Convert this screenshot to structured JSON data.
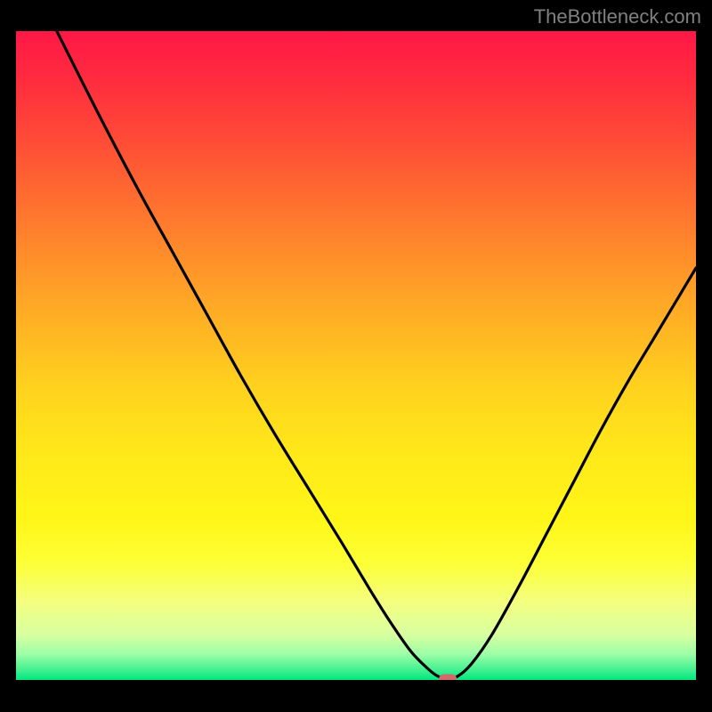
{
  "watermark": "TheBottleneck.com",
  "chart_data": {
    "type": "line",
    "title": "",
    "xlabel": "",
    "ylabel": "",
    "xlim": [
      0,
      100
    ],
    "ylim": [
      0,
      100
    ],
    "gradient_stops": [
      {
        "offset": 0.0,
        "color": "#ff1846"
      },
      {
        "offset": 0.07,
        "color": "#ff2a3f"
      },
      {
        "offset": 0.15,
        "color": "#ff4538"
      },
      {
        "offset": 0.25,
        "color": "#ff6a30"
      },
      {
        "offset": 0.35,
        "color": "#ff8f2a"
      },
      {
        "offset": 0.45,
        "color": "#ffb224"
      },
      {
        "offset": 0.55,
        "color": "#ffd21e"
      },
      {
        "offset": 0.65,
        "color": "#ffe81a"
      },
      {
        "offset": 0.75,
        "color": "#fff617"
      },
      {
        "offset": 0.82,
        "color": "#fdff36"
      },
      {
        "offset": 0.88,
        "color": "#f4ff80"
      },
      {
        "offset": 0.93,
        "color": "#d8ffa0"
      },
      {
        "offset": 0.96,
        "color": "#9effa8"
      },
      {
        "offset": 0.985,
        "color": "#40f090"
      },
      {
        "offset": 1.0,
        "color": "#00e87c"
      }
    ],
    "curve": {
      "description": "Bottleneck curve — steep descent from left, minimum near 63% x, rising to right",
      "points": [
        {
          "x": 6.0,
          "y": 100.0
        },
        {
          "x": 12.0,
          "y": 87.5
        },
        {
          "x": 18.0,
          "y": 75.5
        },
        {
          "x": 23.0,
          "y": 66.0
        },
        {
          "x": 28.0,
          "y": 56.5
        },
        {
          "x": 33.0,
          "y": 47.0
        },
        {
          "x": 38.0,
          "y": 38.0
        },
        {
          "x": 43.0,
          "y": 29.5
        },
        {
          "x": 48.0,
          "y": 21.0
        },
        {
          "x": 52.0,
          "y": 14.0
        },
        {
          "x": 55.0,
          "y": 9.0
        },
        {
          "x": 58.0,
          "y": 4.5
        },
        {
          "x": 60.5,
          "y": 1.8
        },
        {
          "x": 62.0,
          "y": 0.6
        },
        {
          "x": 63.5,
          "y": 0.2
        },
        {
          "x": 65.0,
          "y": 0.6
        },
        {
          "x": 67.0,
          "y": 2.5
        },
        {
          "x": 70.0,
          "y": 7.0
        },
        {
          "x": 74.0,
          "y": 14.5
        },
        {
          "x": 78.0,
          "y": 22.5
        },
        {
          "x": 82.0,
          "y": 30.5
        },
        {
          "x": 86.0,
          "y": 38.5
        },
        {
          "x": 90.0,
          "y": 46.0
        },
        {
          "x": 94.0,
          "y": 53.0
        },
        {
          "x": 98.0,
          "y": 60.0
        },
        {
          "x": 100.0,
          "y": 63.5
        }
      ]
    },
    "marker": {
      "x": 63.5,
      "y": 0.2,
      "color": "#d46a6a",
      "width_pct": 2.6,
      "height_pct": 1.4
    }
  }
}
